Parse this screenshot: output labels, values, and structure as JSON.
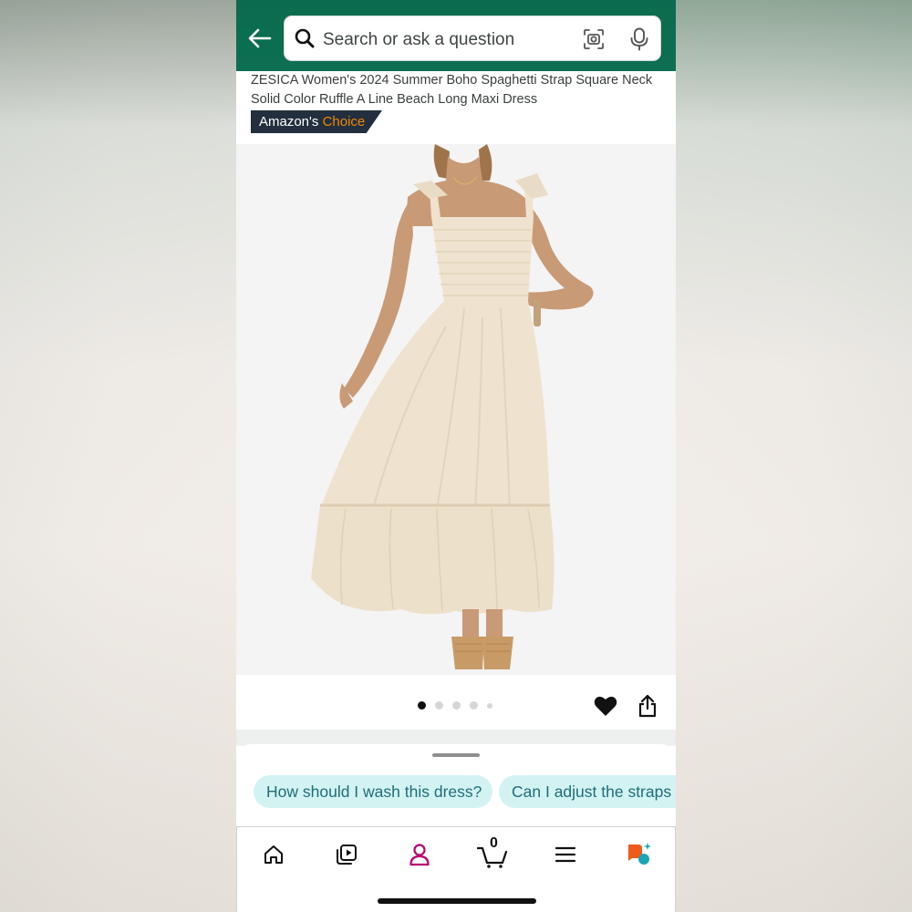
{
  "header": {
    "search_placeholder": "Search or ask a question",
    "back_icon": "back-arrow-icon",
    "search_icon": "search-icon",
    "camera_icon": "camera-lens-icon",
    "mic_icon": "microphone-icon"
  },
  "product": {
    "title": "ZESICA Women's 2024 Summer Boho Spaghetti Strap Square Neck Solid Color Ruffle A Line Beach Long Maxi Dress",
    "badge_prefix": "Amazon's",
    "badge_highlight": "Choice",
    "image_alt": "Model wearing a cream maxi dress with tie straps and ruffle hem",
    "image_count": 5,
    "current_image": 1
  },
  "actions": {
    "wishlist_icon": "heart-icon",
    "share_icon": "share-icon"
  },
  "ai_suggestions": [
    "How should I wash this dress?",
    "Can I adjust the straps"
  ],
  "bottom_nav": {
    "items": [
      {
        "icon": "home-icon"
      },
      {
        "icon": "video-play-icon"
      },
      {
        "icon": "account-icon"
      },
      {
        "icon": "cart-icon",
        "count": "0"
      },
      {
        "icon": "menu-icon"
      },
      {
        "icon": "ai-assistant-icon"
      }
    ]
  },
  "colors": {
    "header_green": "#0b6b4e",
    "badge_dark": "#232f3e",
    "badge_orange": "#f08804",
    "chip_bg": "#d3f3f3",
    "chip_text": "#1f6d77",
    "account_active": "#b3006f"
  }
}
